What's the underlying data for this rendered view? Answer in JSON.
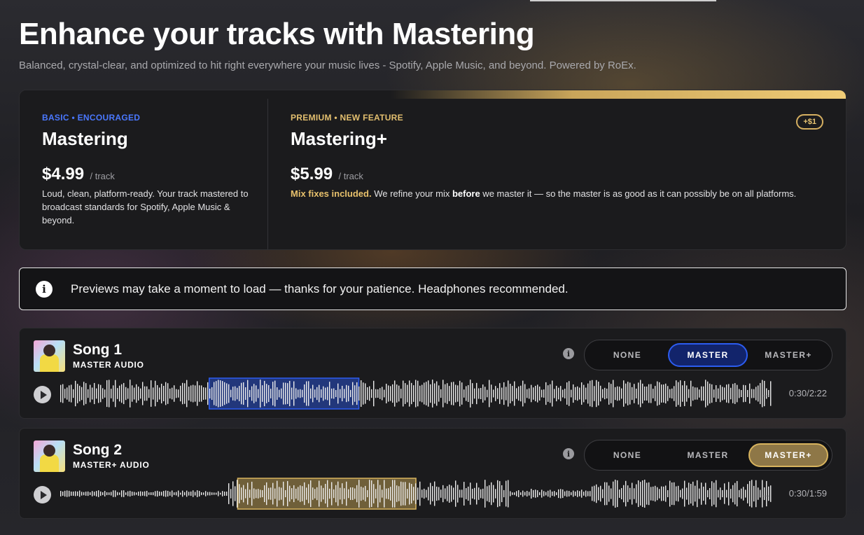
{
  "header": {
    "title": "Enhance your tracks with Mastering",
    "subtitle": "Balanced, crystal-clear, and optimized to hit right everywhere your music lives - Spotify, Apple Music, and beyond. Powered by RoEx."
  },
  "plans": {
    "basic": {
      "eyebrow": "BASIC • ENCOURAGED",
      "name": "Mastering",
      "price": "$4.99",
      "unit": "/ track",
      "description": "Loud, clean, platform-ready. Your track mastered to broadcast standards for Spotify, Apple Music & beyond."
    },
    "premium": {
      "eyebrow": "PREMIUM • NEW FEATURE",
      "name": "Mastering+",
      "price": "$5.99",
      "unit": "/ track",
      "badge": "+$1",
      "desc_highlight": "Mix fixes included.",
      "desc_part1": " We refine your mix ",
      "desc_bold": "before",
      "desc_part2": " we master it — so the master is as good as it can possibly be on all platforms."
    }
  },
  "notice": {
    "icon": "info-icon",
    "text": "Previews may take a moment to load — thanks for your patience. Headphones recommended."
  },
  "options": [
    "NONE",
    "MASTER",
    "MASTER+"
  ],
  "tracks": [
    {
      "name": "Song 1",
      "subtitle": "MASTER AUDIO",
      "selected": "MASTER",
      "time": "0:30/2:22",
      "highlight_color": "#2c5cf0",
      "highlight_start": 0.21,
      "highlight_end": 0.42
    },
    {
      "name": "Song 2",
      "subtitle": "MASTER+ AUDIO",
      "selected": "MASTER+",
      "time": "0:30/1:59",
      "highlight_color": "#d8b45e",
      "highlight_start": 0.25,
      "highlight_end": 0.5
    }
  ],
  "colors": {
    "basic_accent": "#4a78ff",
    "premium_accent": "#e3bf6f",
    "card_bg": "#1b1b1d"
  }
}
